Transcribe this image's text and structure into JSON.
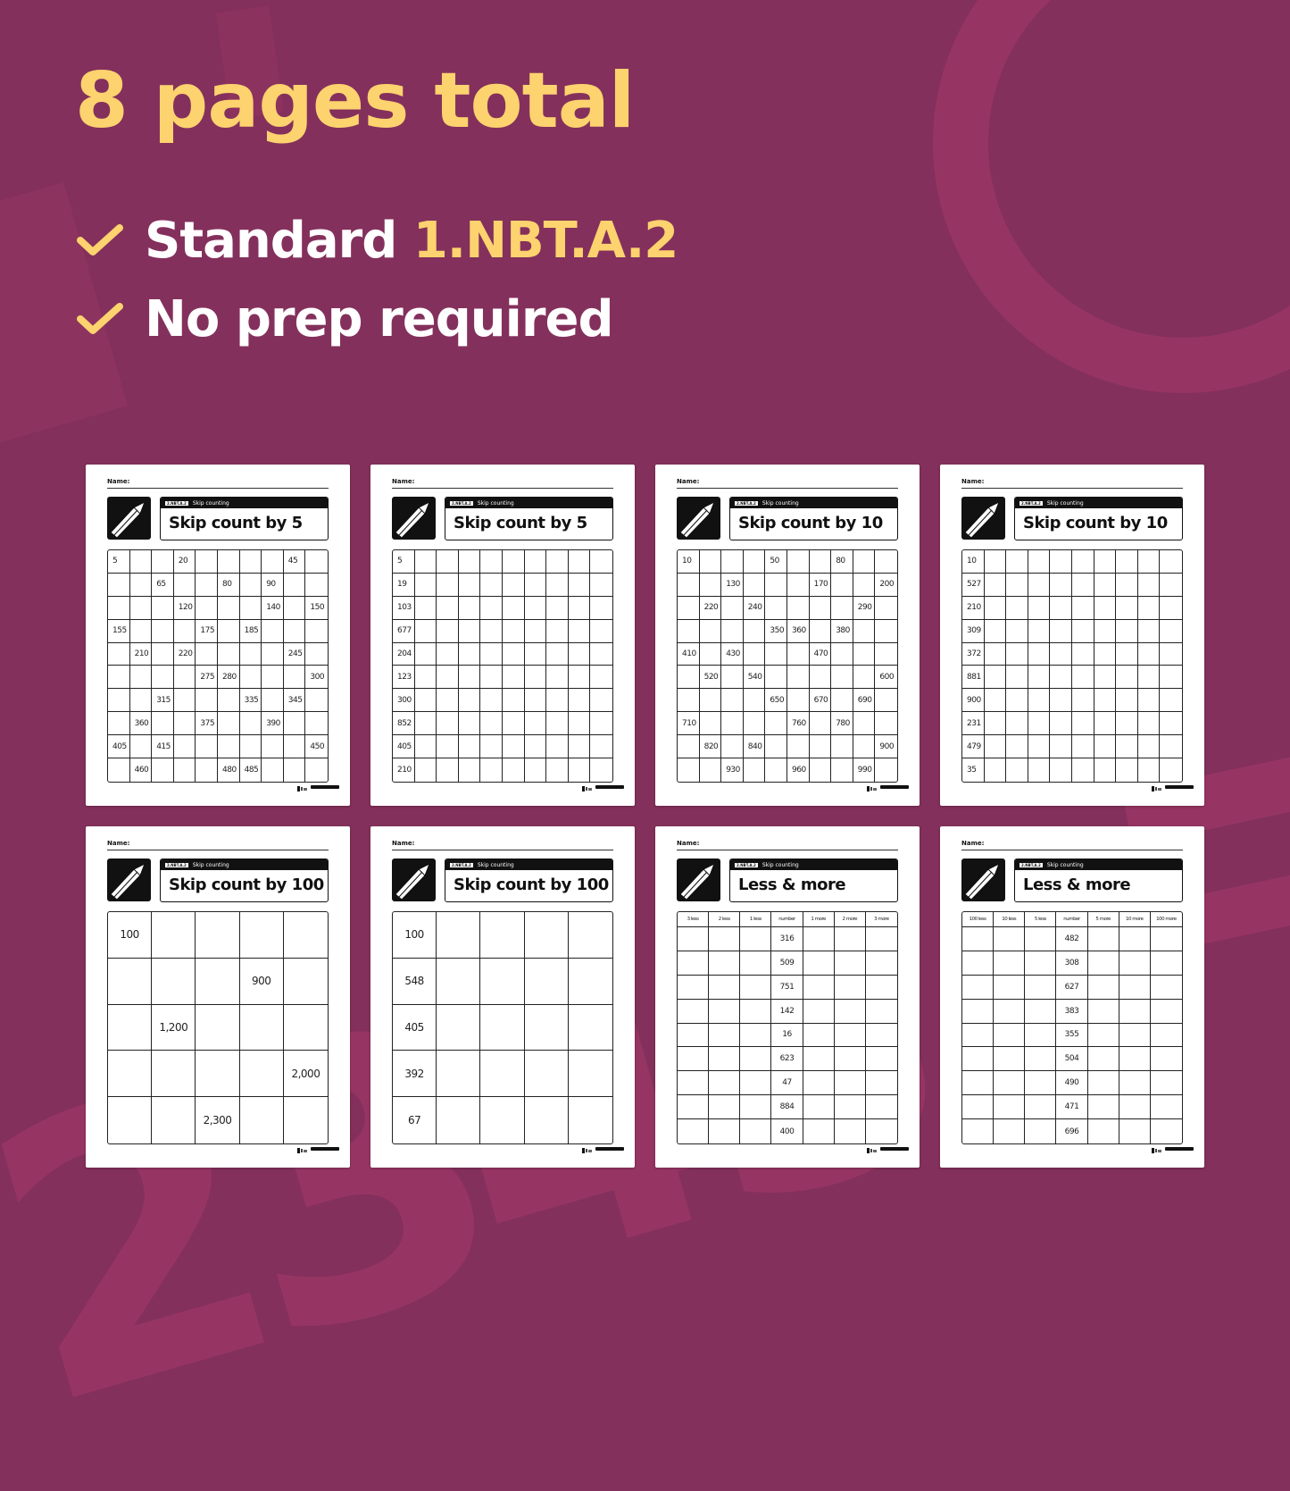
{
  "headline": "8 pages total",
  "bullets": [
    {
      "icon": "check-icon",
      "text": "Standard ",
      "accent": "1.NBT.A.2"
    },
    {
      "icon": "check-icon",
      "text": "No prep required",
      "accent": ""
    }
  ],
  "colors": {
    "background": "#84305c",
    "accent": "#fcd36e",
    "text": "#ffffff",
    "decor": "#963564"
  },
  "decor_digits": "2345",
  "worksheet_common": {
    "name_label": "Name:",
    "standard_badge": "2.NBT.A.2",
    "topic": "Skip counting"
  },
  "worksheets": [
    {
      "title": "Skip count by 5",
      "layout": "grid10",
      "rows": [
        [
          "5",
          "",
          "",
          "20",
          "",
          "",
          "",
          "",
          "45",
          ""
        ],
        [
          "",
          "",
          "65",
          "",
          "",
          "80",
          "",
          "90",
          "",
          ""
        ],
        [
          "",
          "",
          "",
          "120",
          "",
          "",
          "",
          "140",
          "",
          "150"
        ],
        [
          "155",
          "",
          "",
          "",
          "175",
          "",
          "185",
          "",
          "",
          ""
        ],
        [
          "",
          "210",
          "",
          "220",
          "",
          "",
          "",
          "",
          "245",
          ""
        ],
        [
          "",
          "",
          "",
          "",
          "275",
          "280",
          "",
          "",
          "",
          "300"
        ],
        [
          "",
          "",
          "315",
          "",
          "",
          "",
          "335",
          "",
          "345",
          ""
        ],
        [
          "",
          "360",
          "",
          "",
          "375",
          "",
          "",
          "390",
          "",
          ""
        ],
        [
          "405",
          "",
          "415",
          "",
          "",
          "",
          "",
          "",
          "",
          "450"
        ],
        [
          "",
          "460",
          "",
          "",
          "",
          "480",
          "485",
          "",
          "",
          ""
        ]
      ]
    },
    {
      "title": "Skip count by 5",
      "layout": "grid10",
      "rows": [
        [
          "5",
          "",
          "",
          "",
          "",
          "",
          "",
          "",
          "",
          ""
        ],
        [
          "19",
          "",
          "",
          "",
          "",
          "",
          "",
          "",
          "",
          ""
        ],
        [
          "103",
          "",
          "",
          "",
          "",
          "",
          "",
          "",
          "",
          ""
        ],
        [
          "677",
          "",
          "",
          "",
          "",
          "",
          "",
          "",
          "",
          ""
        ],
        [
          "204",
          "",
          "",
          "",
          "",
          "",
          "",
          "",
          "",
          ""
        ],
        [
          "123",
          "",
          "",
          "",
          "",
          "",
          "",
          "",
          "",
          ""
        ],
        [
          "300",
          "",
          "",
          "",
          "",
          "",
          "",
          "",
          "",
          ""
        ],
        [
          "852",
          "",
          "",
          "",
          "",
          "",
          "",
          "",
          "",
          ""
        ],
        [
          "405",
          "",
          "",
          "",
          "",
          "",
          "",
          "",
          "",
          ""
        ],
        [
          "210",
          "",
          "",
          "",
          "",
          "",
          "",
          "",
          "",
          ""
        ]
      ]
    },
    {
      "title": "Skip count by 10",
      "layout": "grid10",
      "rows": [
        [
          "10",
          "",
          "",
          "",
          "50",
          "",
          "",
          "80",
          "",
          ""
        ],
        [
          "",
          "",
          "130",
          "",
          "",
          "",
          "170",
          "",
          "",
          "200"
        ],
        [
          "",
          "220",
          "",
          "240",
          "",
          "",
          "",
          "",
          "290",
          ""
        ],
        [
          "",
          "",
          "",
          "",
          "350",
          "360",
          "",
          "380",
          "",
          ""
        ],
        [
          "410",
          "",
          "430",
          "",
          "",
          "",
          "470",
          "",
          "",
          ""
        ],
        [
          "",
          "520",
          "",
          "540",
          "",
          "",
          "",
          "",
          "",
          "600"
        ],
        [
          "",
          "",
          "",
          "",
          "650",
          "",
          "670",
          "",
          "690",
          ""
        ],
        [
          "710",
          "",
          "",
          "",
          "",
          "760",
          "",
          "780",
          "",
          ""
        ],
        [
          "",
          "820",
          "",
          "840",
          "",
          "",
          "",
          "",
          "",
          "900"
        ],
        [
          "",
          "",
          "930",
          "",
          "",
          "960",
          "",
          "",
          "990",
          ""
        ]
      ]
    },
    {
      "title": "Skip count by 10",
      "layout": "grid10",
      "rows": [
        [
          "10",
          "",
          "",
          "",
          "",
          "",
          "",
          "",
          "",
          ""
        ],
        [
          "527",
          "",
          "",
          "",
          "",
          "",
          "",
          "",
          "",
          ""
        ],
        [
          "210",
          "",
          "",
          "",
          "",
          "",
          "",
          "",
          "",
          ""
        ],
        [
          "309",
          "",
          "",
          "",
          "",
          "",
          "",
          "",
          "",
          ""
        ],
        [
          "372",
          "",
          "",
          "",
          "",
          "",
          "",
          "",
          "",
          ""
        ],
        [
          "881",
          "",
          "",
          "",
          "",
          "",
          "",
          "",
          "",
          ""
        ],
        [
          "900",
          "",
          "",
          "",
          "",
          "",
          "",
          "",
          "",
          ""
        ],
        [
          "231",
          "",
          "",
          "",
          "",
          "",
          "",
          "",
          "",
          ""
        ],
        [
          "479",
          "",
          "",
          "",
          "",
          "",
          "",
          "",
          "",
          ""
        ],
        [
          "35",
          "",
          "",
          "",
          "",
          "",
          "",
          "",
          "",
          ""
        ]
      ]
    },
    {
      "title": "Skip count by 100",
      "layout": "grid5",
      "rows": [
        [
          "100",
          "",
          "",
          "",
          ""
        ],
        [
          "",
          "",
          "",
          "900",
          ""
        ],
        [
          "",
          "1,200",
          "",
          "",
          ""
        ],
        [
          "",
          "",
          "",
          "",
          "2,000"
        ],
        [
          "",
          "",
          "2,300",
          "",
          ""
        ]
      ]
    },
    {
      "title": "Skip count by 100",
      "layout": "grid5",
      "rows": [
        [
          "100",
          "",
          "",
          "",
          ""
        ],
        [
          "548",
          "",
          "",
          "",
          ""
        ],
        [
          "405",
          "",
          "",
          "",
          ""
        ],
        [
          "392",
          "",
          "",
          "",
          ""
        ],
        [
          "67",
          "",
          "",
          "",
          ""
        ]
      ]
    },
    {
      "title": "Less & more",
      "layout": "table7",
      "headers": [
        "3 less",
        "2 less",
        "1 less",
        "number",
        "1 more",
        "2 more",
        "3 more"
      ],
      "numbers": [
        "316",
        "509",
        "751",
        "142",
        "16",
        "623",
        "47",
        "884",
        "400"
      ]
    },
    {
      "title": "Less & more",
      "layout": "table7",
      "headers": [
        "100 less",
        "10 less",
        "5 less",
        "number",
        "5 more",
        "10 more",
        "100 more"
      ],
      "numbers": [
        "482",
        "308",
        "627",
        "383",
        "355",
        "504",
        "490",
        "471",
        "696"
      ]
    }
  ]
}
